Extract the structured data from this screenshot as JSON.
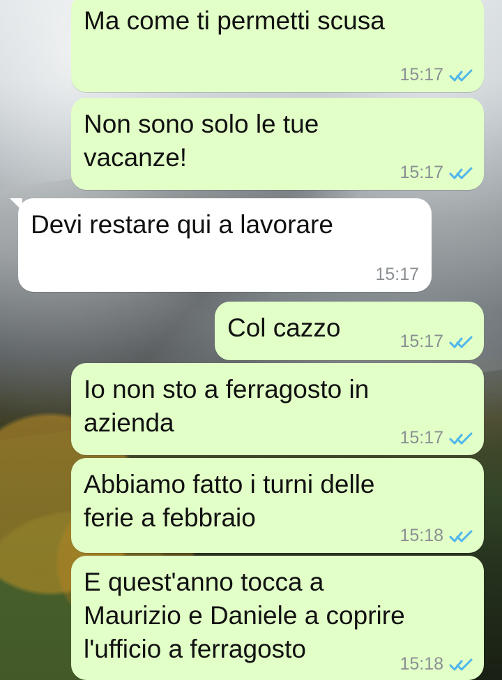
{
  "messages": [
    {
      "id": "m1",
      "direction": "out",
      "text": "Ma come ti permetti scusa",
      "time": "15:17",
      "status": "read"
    },
    {
      "id": "m2",
      "direction": "out",
      "text": "Non sono solo le tue\nvacanze!",
      "time": "15:17",
      "status": "read"
    },
    {
      "id": "m3",
      "direction": "in",
      "text": "Devi restare qui a lavorare",
      "time": "15:17",
      "status": ""
    },
    {
      "id": "m4",
      "direction": "out",
      "text": "Col cazzo",
      "time": "15:17",
      "status": "read"
    },
    {
      "id": "m5",
      "direction": "out",
      "text": "Io non sto a ferragosto in\nazienda",
      "time": "15:17",
      "status": "read"
    },
    {
      "id": "m6",
      "direction": "out",
      "text": "Abbiamo fatto i turni delle\nferie a febbraio",
      "time": "15:18",
      "status": "read"
    },
    {
      "id": "m7",
      "direction": "out",
      "text": "E quest'anno tocca a\nMaurizio e Daniele a coprire\nl'ufficio a ferragosto",
      "time": "15:18",
      "status": "read"
    }
  ],
  "colors": {
    "outgoing_bubble": "#e1ffc7",
    "incoming_bubble": "#ffffff",
    "timestamp": "#8a8f93",
    "read_ticks": "#4fb6ec"
  },
  "icons": {
    "read_receipt": "double-check-icon"
  }
}
